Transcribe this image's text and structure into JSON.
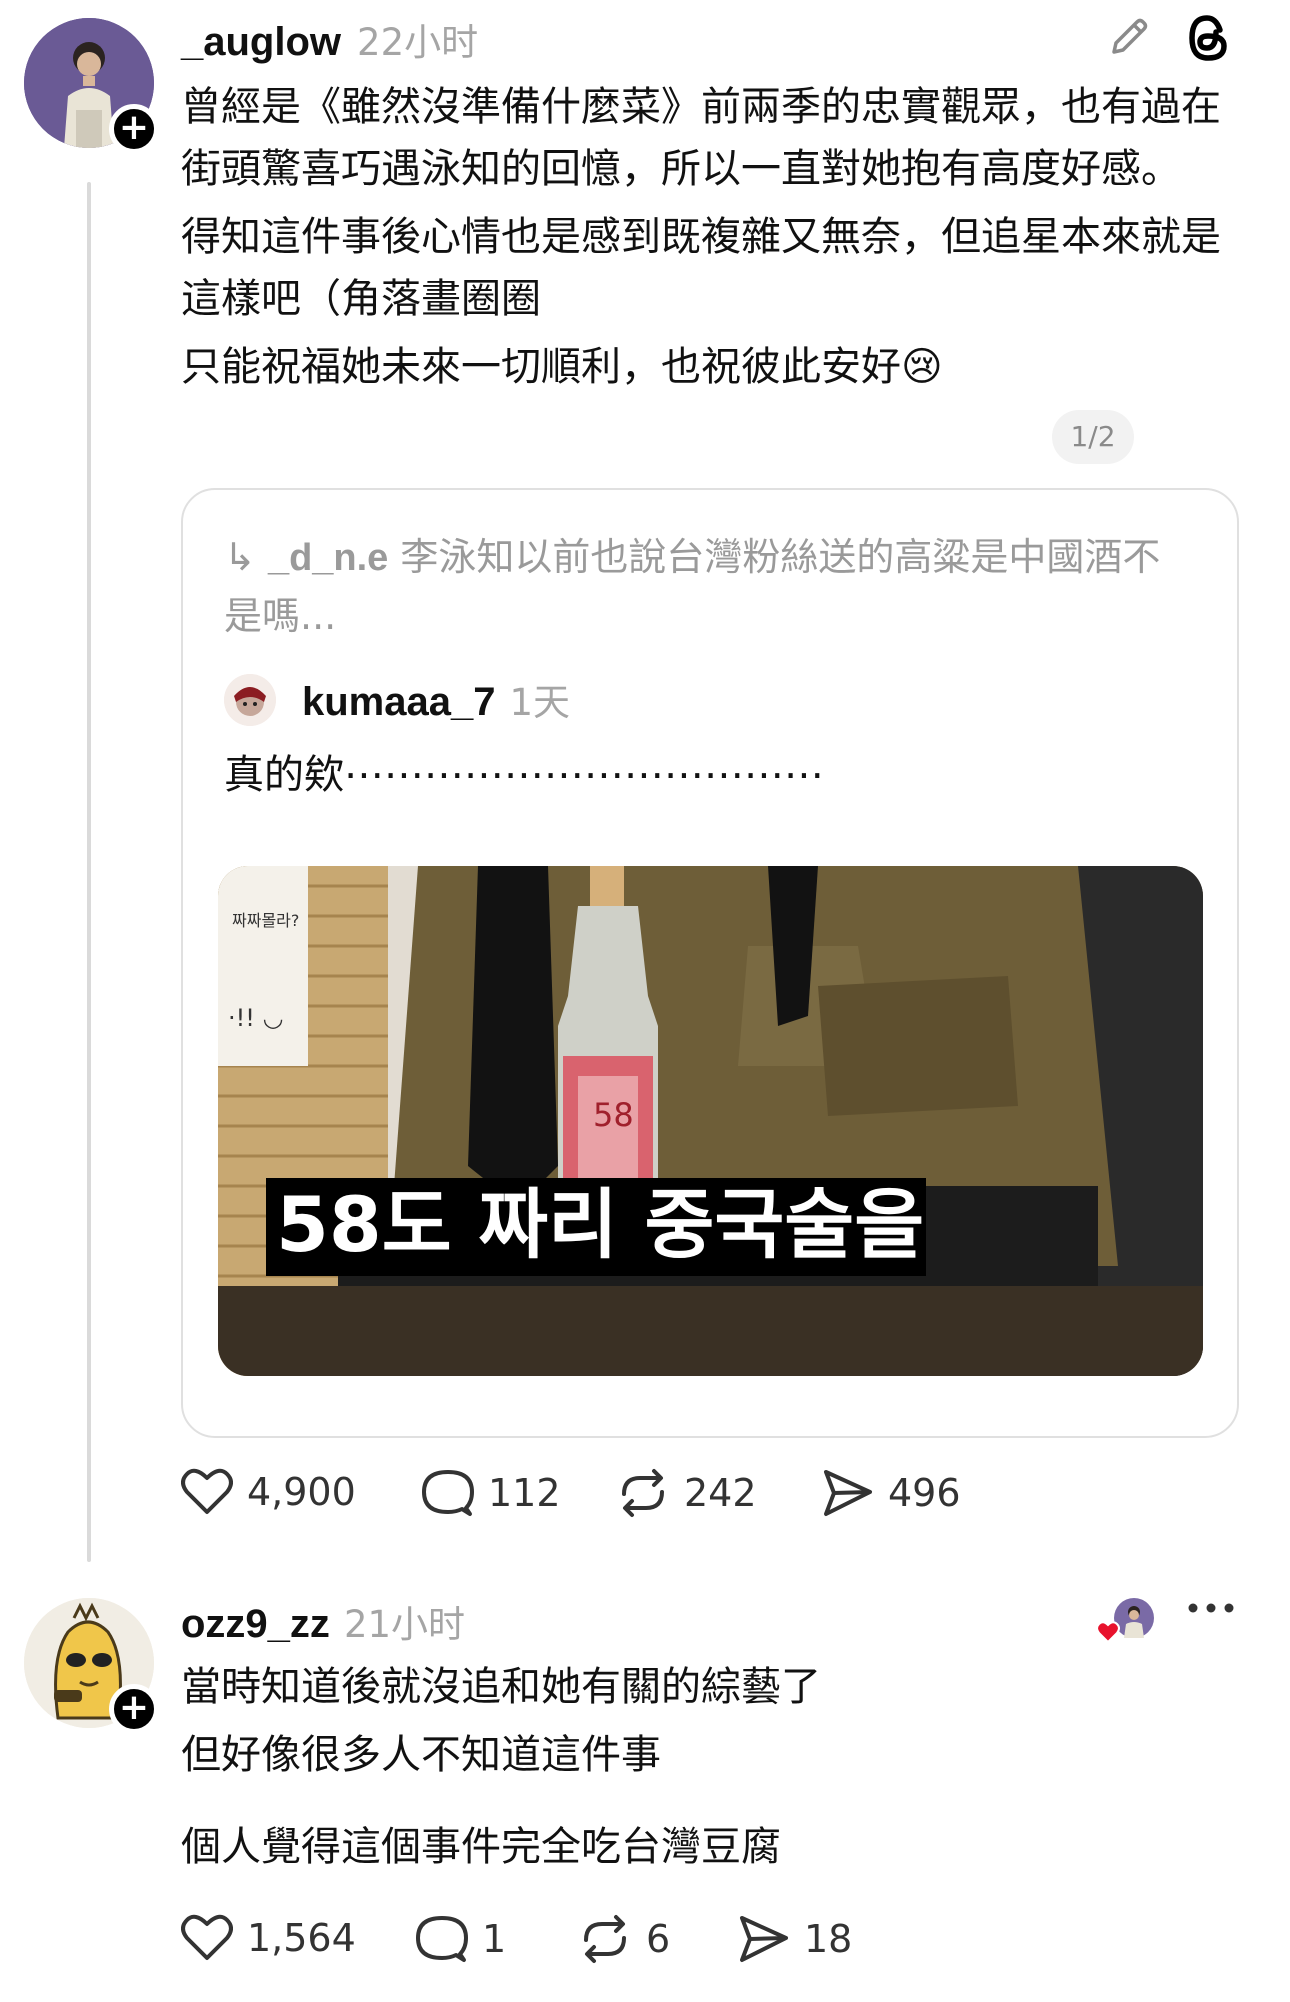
{
  "post1": {
    "username": "_auglow",
    "time": "22小时",
    "paragraphs": [
      "曾經是《雖然沒準備什麼菜》前兩季的忠實觀眾，也有過在街頭驚喜巧遇泳知的回憶，所以一直對她抱有高度好感。",
      "得知這件事後心情也是感到既複雜又無奈，但追星本來就是這樣吧（角落畫圈圈",
      "只能祝福她未來一切順利，也祝彼此安好"
    ],
    "emoji": "😢",
    "page_indicator": "1/2",
    "quote": {
      "reply_arrow": "↳",
      "reply_to_handle": "_d_n.e",
      "reply_to_text": "李泳知以前也說台灣粉絲送的高粱是中國酒不是嗎...",
      "username": "kumaaa_7",
      "time": "1天",
      "text": "真的欸⋯⋯⋯⋯⋯⋯⋯⋯⋯⋯⋯⋯",
      "image_caption": "58도 짜리 중국술을",
      "image_sign_text": "짜짜몰라?",
      "image_label_number": "58"
    },
    "stats": {
      "likes": "4,900",
      "comments": "112",
      "reposts": "242",
      "shares": "496"
    }
  },
  "post2": {
    "username": "ozz9_zz",
    "time": "21小时",
    "lines": [
      "當時知道後就沒追和她有關的綜藝了",
      "但好像很多人不知道這件事",
      "個人覺得這個事件完全吃台灣豆腐"
    ],
    "stats": {
      "likes": "1,564",
      "comments": "1",
      "reposts": "6",
      "shares": "18"
    }
  },
  "icons": [
    "edit-icon",
    "threads-logo-icon",
    "heart-icon",
    "comment-icon",
    "repost-icon",
    "share-icon",
    "more-icon",
    "liked-by-author-icon"
  ],
  "colors": {
    "heart_red": "#e8122d",
    "muted": "#a5a5a5",
    "border": "#e0e0e0"
  }
}
